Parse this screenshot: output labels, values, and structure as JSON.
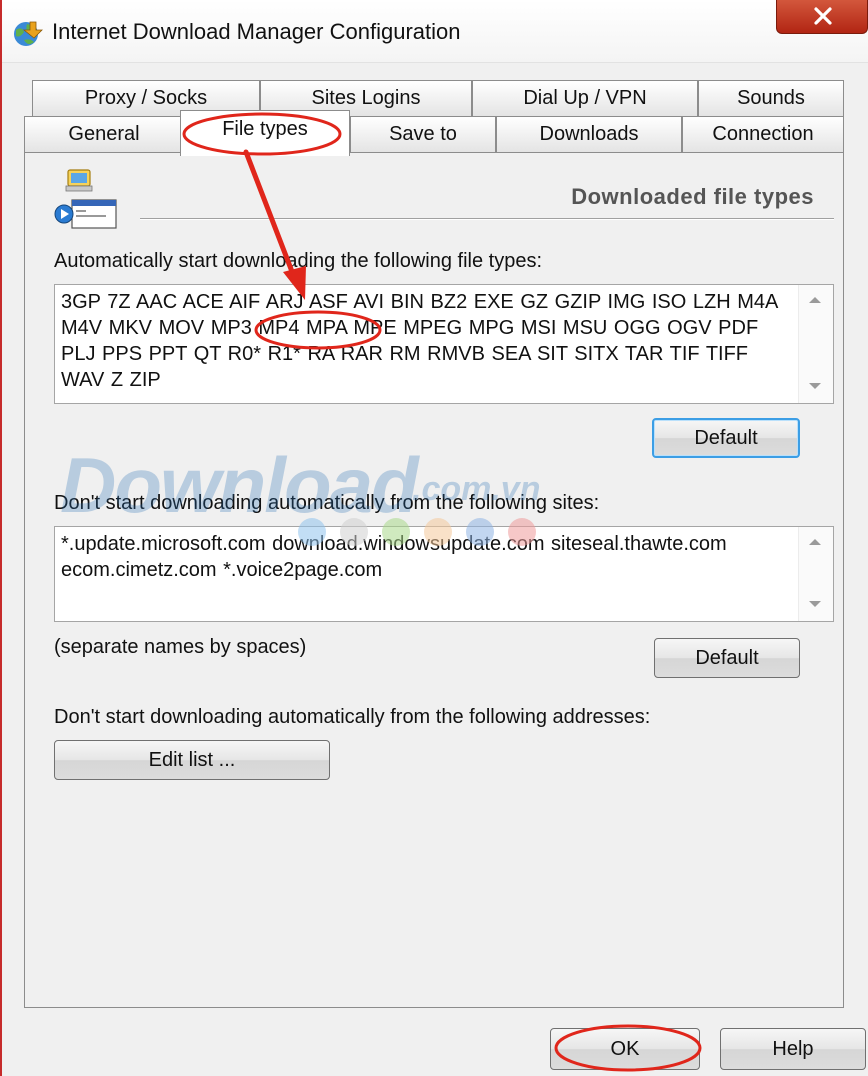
{
  "window": {
    "title": "Internet Download Manager Configuration",
    "app_icon": "idm-globe-icon",
    "close_icon": "close-icon",
    "close_color": "#c0341d"
  },
  "tabs": {
    "row1": [
      {
        "label": "Proxy / Socks"
      },
      {
        "label": "Sites Logins"
      },
      {
        "label": "Dial Up / VPN"
      },
      {
        "label": "Sounds"
      }
    ],
    "row2": [
      {
        "label": "General"
      },
      {
        "label": "File types",
        "active": true
      },
      {
        "label": "Save to"
      },
      {
        "label": "Downloads"
      },
      {
        "label": "Connection"
      }
    ]
  },
  "page": {
    "section_icon": "file-types-icon",
    "header": "Downloaded file types",
    "file_types_label": "Automatically start downloading the following file types:",
    "file_types_value": "3GP 7Z AAC ACE AIF ARJ ASF AVI BIN BZ2 EXE GZ GZIP IMG ISO LZH M4A M4V MKV MOV MP3 MP4 MPA MPE MPEG MPG MSI MSU OGG OGV PDF PLJ PPS PPT QT R0* R1* RA RAR RM RMVB SEA SIT SITX TAR TIF TIFF WAV  Z ZIP",
    "file_types_default_button": "Default",
    "sites_label": "Don't start downloading automatically from the following sites:",
    "sites_value": "*.update.microsoft.com download.windowsupdate.com siteseal.thawte.com ecom.cimetz.com *.voice2page.com",
    "sites_hint": "(separate names by spaces)",
    "sites_default_button": "Default",
    "addresses_label": "Don't start downloading automatically from the following addresses:",
    "edit_list_button": "Edit list ..."
  },
  "footer": {
    "ok_button": "OK",
    "help_button": "Help"
  },
  "watermark": {
    "brand": "Download",
    "domain": ".com.vn",
    "dot_colors": [
      "#8fc3ec",
      "#d0d0d0",
      "#a9d88b",
      "#f4c89a",
      "#8fb4e3",
      "#ee9a9a"
    ]
  },
  "annotation": {
    "color": "#e0261b"
  }
}
